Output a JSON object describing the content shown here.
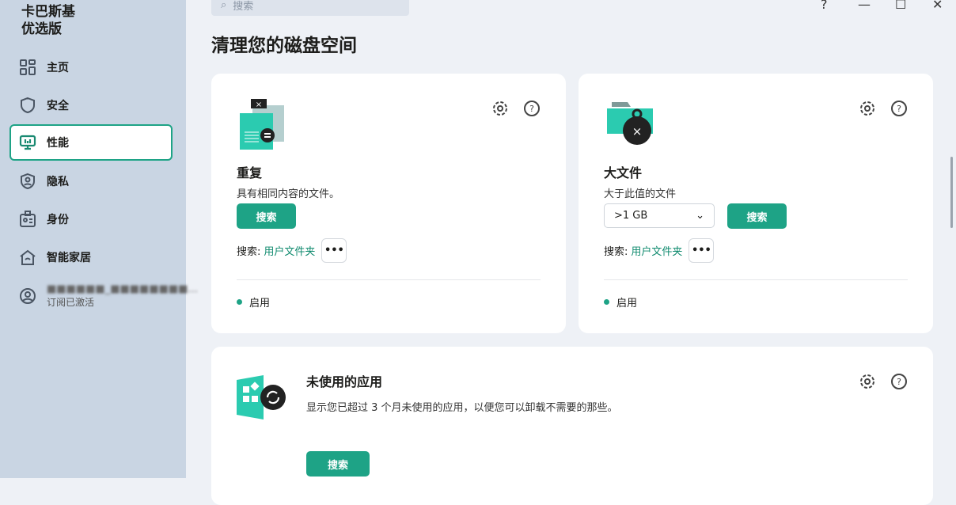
{
  "app": {
    "brand_line1": "卡巴斯基",
    "brand_line2": "优选版"
  },
  "sidebar": {
    "items": [
      {
        "label": "主页"
      },
      {
        "label": "安全"
      },
      {
        "label": "性能"
      },
      {
        "label": "隐私"
      },
      {
        "label": "身份"
      },
      {
        "label": "智能家居"
      }
    ],
    "user": {
      "name": "■■■■■■_■■■■■■■■...",
      "status": "订阅已激活"
    }
  },
  "search": {
    "placeholder": "搜索"
  },
  "window": {
    "help": "?",
    "minimize": "—",
    "maximize": "☐",
    "close": "✕"
  },
  "page": {
    "title": "清理您的磁盘空间"
  },
  "cards": [
    {
      "title": "重复",
      "desc": "具有相同内容的文件。",
      "button": "搜索",
      "loc_label": "搜索:",
      "loc_link": "用户文件夹",
      "more": "•••",
      "status": "启用"
    },
    {
      "title": "大文件",
      "desc": "大于此值的文件",
      "select": ">1 GB",
      "button": "搜索",
      "loc_label": "搜索:",
      "loc_link": "用户文件夹",
      "more": "•••",
      "status": "启用"
    },
    {
      "title": "未使用的应用",
      "desc": "显示您已超过 3 个月未使用的应用，以便您可以卸载不需要的那些。",
      "button": "搜索"
    }
  ],
  "colors": {
    "accent": "#1ea386",
    "sidebar": "#c9d5e3"
  }
}
